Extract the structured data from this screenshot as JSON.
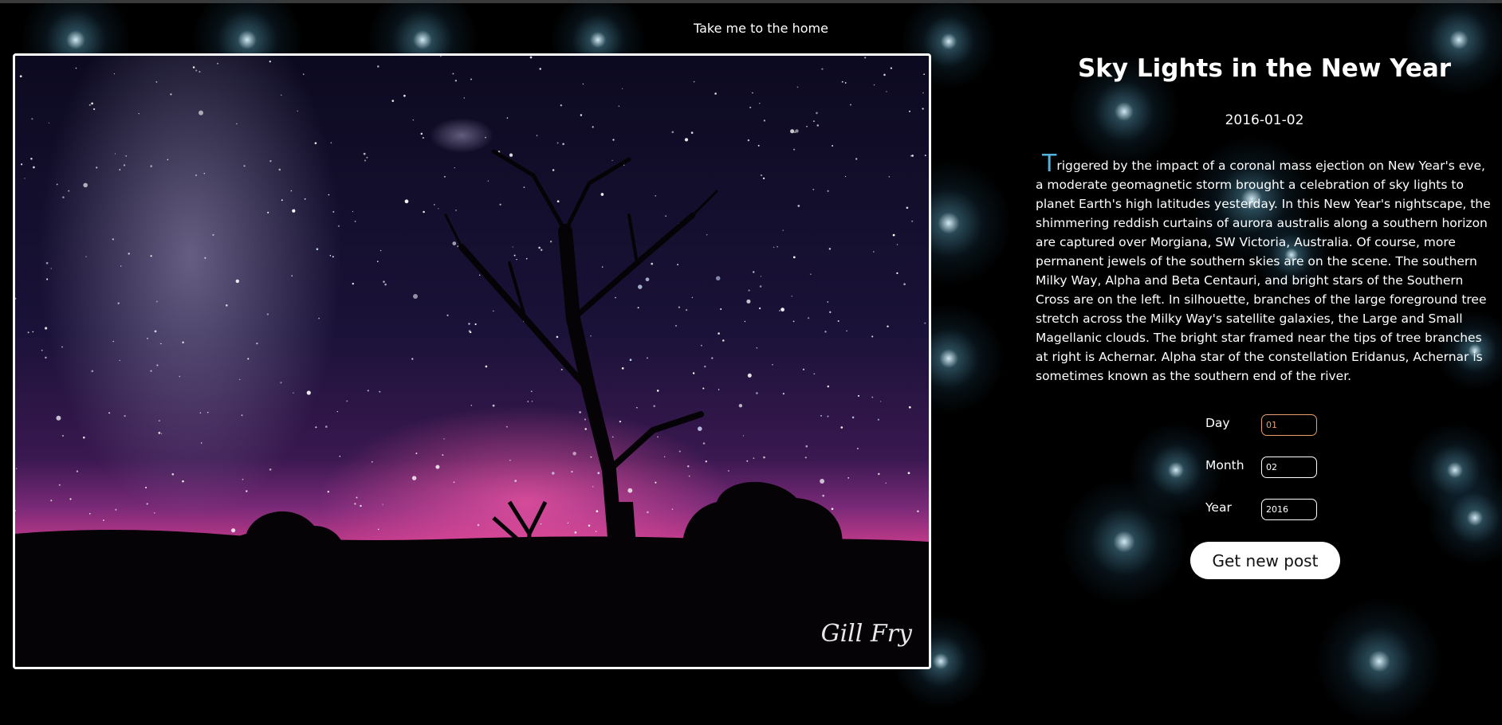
{
  "nav": {
    "home_link": "Take me to the home"
  },
  "post": {
    "title": "Sky Lights in the New Year",
    "date": "2016-01-02",
    "explanation_first_letter": "T",
    "explanation_rest": "riggered by the impact of a coronal mass ejection on New Year's eve, a moderate geomagnetic storm brought a celebration of sky lights to planet Earth's high latitudes yesterday. In this New Year's nightscape, the shimmering reddish curtains of aurora australis along a southern horizon are captured over Morgiana, SW Victoria, Australia. Of course, more permanent jewels of the southern skies are on the scene. The southern Milky Way, Alpha and Beta Centauri, and bright stars of the Southern Cross are on the left. In silhouette, branches of the large foreground tree stretch across the Milky Way's satellite galaxies, the Large and Small Magellanic clouds. The bright star framed near the tips of tree branches at right is Achernar. Alpha star of the constellation Eridanus, Achernar is sometimes known as the southern end of the river.",
    "image_signature": "Gill Fry"
  },
  "form": {
    "day_label": "Day",
    "day_value": "01",
    "month_label": "Month",
    "month_value": "02",
    "year_label": "Year",
    "year_value": "2016",
    "submit_label": "Get new post"
  },
  "colors": {
    "background": "#000000",
    "accent_dropcap": "#4fb3df",
    "active_input": "#e8a070",
    "button_bg": "#ffffff"
  }
}
